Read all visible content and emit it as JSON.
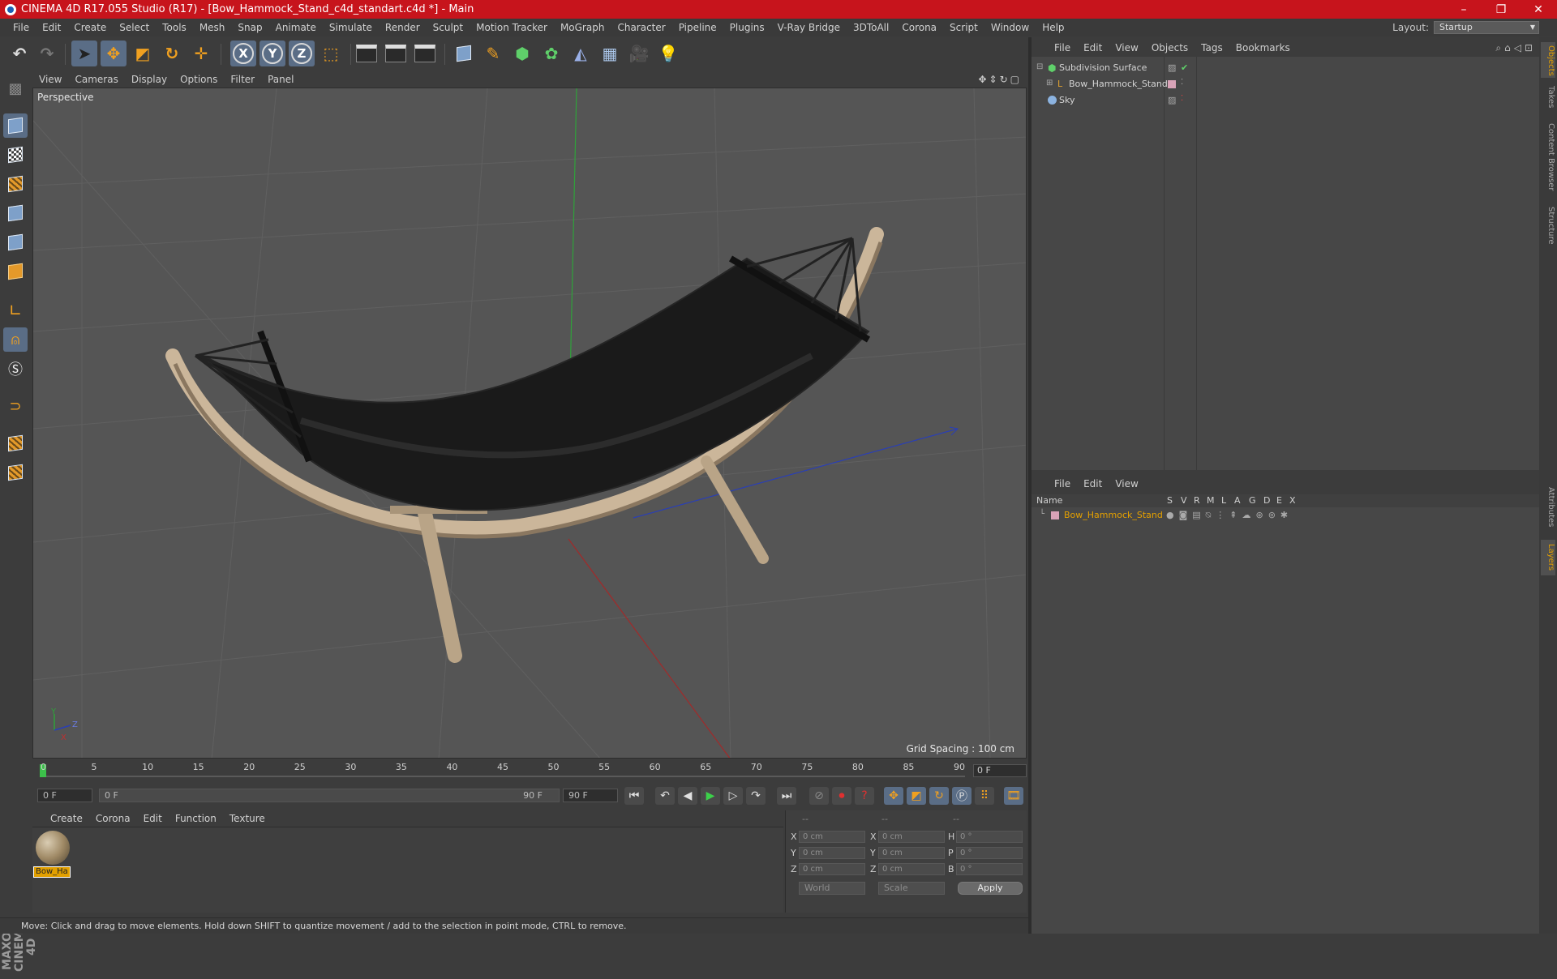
{
  "window": {
    "title": "CINEMA 4D R17.055 Studio (R17) - [Bow_Hammock_Stand_c4d_standart.c4d *] - Main",
    "controls": [
      "–",
      "❐",
      "✕"
    ]
  },
  "menubar": {
    "items": [
      "File",
      "Edit",
      "Create",
      "Select",
      "Tools",
      "Mesh",
      "Snap",
      "Animate",
      "Simulate",
      "Render",
      "Sculpt",
      "Motion Tracker",
      "MoGraph",
      "Character",
      "Pipeline",
      "Plugins",
      "V-Ray Bridge",
      "3DToAll",
      "Corona",
      "Script",
      "Window",
      "Help"
    ],
    "layout_label": "Layout:",
    "layout_value": "Startup"
  },
  "toolbar": {
    "axis_x": "X",
    "axis_y": "Y",
    "axis_z": "Z"
  },
  "viewport": {
    "menu": [
      "View",
      "Cameras",
      "Display",
      "Options",
      "Filter",
      "Panel"
    ],
    "label": "Perspective",
    "grid_spacing": "Grid Spacing : 100 cm",
    "axis_y": "Y",
    "axis_z": "Z",
    "axis_x": "X"
  },
  "timeline": {
    "ticks": [
      "0",
      "5",
      "10",
      "15",
      "20",
      "25",
      "30",
      "35",
      "40",
      "45",
      "50",
      "55",
      "60",
      "65",
      "70",
      "75",
      "80",
      "85",
      "90"
    ],
    "current_frame": "0 F"
  },
  "transport": {
    "start_field": "0 F",
    "range_start": "0 F",
    "range_end": "90 F",
    "end_field": "90 F"
  },
  "materials": {
    "menu": [
      "Create",
      "Corona",
      "Edit",
      "Function",
      "Texture"
    ],
    "items": [
      {
        "label": "Bow_Ha"
      }
    ]
  },
  "coords": {
    "headers": [
      "--",
      "--",
      "--"
    ],
    "rows": [
      {
        "a": "X",
        "av": "0 cm",
        "b": "X",
        "bv": "0 cm",
        "c": "H",
        "cv": "0 °"
      },
      {
        "a": "Y",
        "av": "0 cm",
        "b": "Y",
        "bv": "0 cm",
        "c": "P",
        "cv": "0 °"
      },
      {
        "a": "Z",
        "av": "0 cm",
        "b": "Z",
        "bv": "0 cm",
        "c": "B",
        "cv": "0 °"
      }
    ],
    "mode": "World",
    "transform": "Scale",
    "apply": "Apply"
  },
  "status": {
    "text": "Move: Click and drag to move elements. Hold down SHIFT to quantize movement / add to the selection in point mode, CTRL to remove."
  },
  "objects": {
    "menu": [
      "File",
      "Edit",
      "View",
      "Objects",
      "Tags",
      "Bookmarks"
    ],
    "items": [
      {
        "name": "Subdivision Surface"
      },
      {
        "name": "Bow_Hammock_Stand"
      },
      {
        "name": "Sky"
      }
    ]
  },
  "layers": {
    "menu": [
      "File",
      "Edit",
      "View"
    ],
    "header_name": "Name",
    "columns": [
      "S",
      "V",
      "R",
      "M",
      "L",
      "A",
      "G",
      "D",
      "E",
      "X"
    ],
    "items": [
      {
        "name": "Bow_Hammock_Stand"
      }
    ]
  },
  "sidetabs": [
    "Objects",
    "Takes",
    "Content Browser",
    "Structure",
    "Attributes",
    "Layers"
  ],
  "colors": {
    "titlebar": "#c7141c",
    "accent_blue": "#5a6d86",
    "layer_name": "#e4a000",
    "grid_axis_x": "#a12a2a",
    "grid_axis_y": "#2fa23a",
    "grid_axis_z": "#2a3fb5"
  }
}
